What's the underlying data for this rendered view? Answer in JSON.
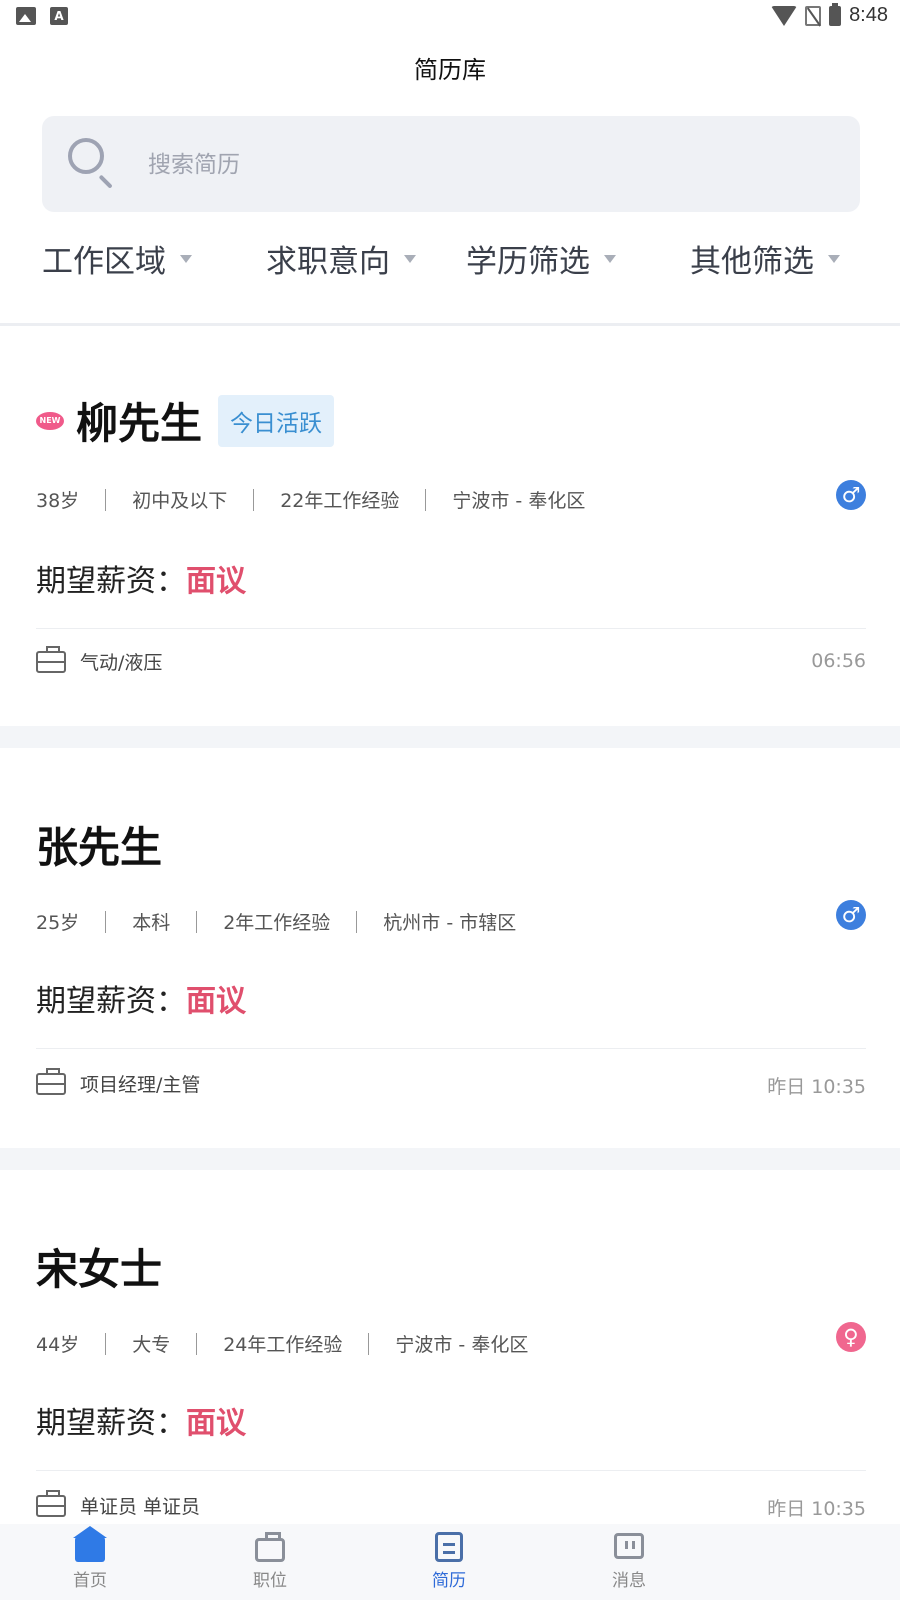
{
  "status_bar": {
    "time": "8:48"
  },
  "header": {
    "title": "简历库"
  },
  "search": {
    "placeholder": "搜索简历"
  },
  "filters": [
    {
      "label": "工作区域"
    },
    {
      "label": "求职意向"
    },
    {
      "label": "学历筛选"
    },
    {
      "label": "其他筛选"
    }
  ],
  "candidates": [
    {
      "name": "柳先生",
      "new_badge": "NEW",
      "active_tag": "今日活跃",
      "age": "38岁",
      "education": "初中及以下",
      "experience": "22年工作经验",
      "location": "宁波市 - 奉化区",
      "gender": "male",
      "gender_symbol": "♂",
      "salary_label": "期望薪资：",
      "salary_value": "面议",
      "job": "气动/液压",
      "time": "06:56"
    },
    {
      "name": "张先生",
      "age": "25岁",
      "education": "本科",
      "experience": "2年工作经验",
      "location": "杭州市 - 市辖区",
      "gender": "male",
      "gender_symbol": "♂",
      "salary_label": "期望薪资：",
      "salary_value": "面议",
      "job": "项目经理/主管",
      "time": "昨日 10:35"
    },
    {
      "name": "宋女士",
      "age": "44岁",
      "education": "大专",
      "experience": "24年工作经验",
      "location": "宁波市 - 奉化区",
      "gender": "female",
      "gender_symbol": "♀",
      "salary_label": "期望薪资：",
      "salary_value": "面议",
      "job": "单证员 单证员",
      "time": "昨日 10:35"
    }
  ],
  "bottom_nav": [
    {
      "label": "首页",
      "icon": "home-icon",
      "active": false
    },
    {
      "label": "职位",
      "icon": "briefcase-icon",
      "active": false
    },
    {
      "label": "简历",
      "icon": "resume-icon",
      "active": true
    },
    {
      "label": "消息",
      "icon": "message-icon",
      "active": false
    }
  ],
  "colors": {
    "accent": "#2f6bd8",
    "salary": "#e04f6d",
    "male": "#3d7fde",
    "female": "#f0678f",
    "active_tag_bg": "#e3f0fb",
    "active_tag_text": "#3a8fd1"
  }
}
